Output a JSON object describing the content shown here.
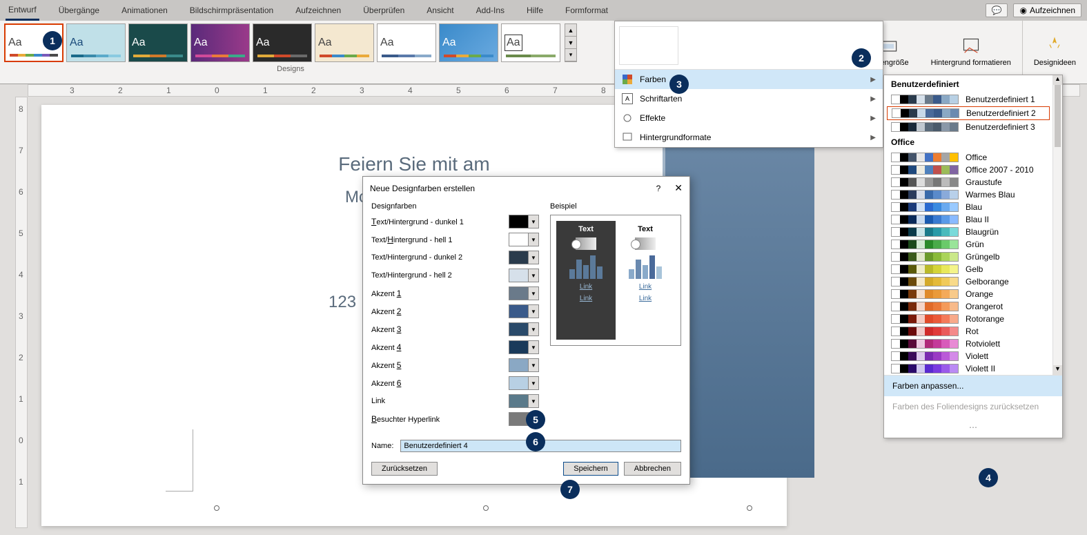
{
  "ribbon": {
    "tabs": [
      "Entwurf",
      "Übergänge",
      "Animationen",
      "Bildschirmpräsentation",
      "Aufzeichnen",
      "Überprüfen",
      "Ansicht",
      "Add-Ins",
      "Hilfe",
      "Formformat"
    ],
    "active": 0,
    "record_btn": "Aufzeichnen",
    "designs_label": "Designs",
    "slide_size": "Foliengröße",
    "format_bg": "Hintergrund formatieren",
    "design_ideas": "Designideen"
  },
  "variants": {
    "colors": "Farben",
    "fonts": "Schriftarten",
    "effects": "Effekte",
    "bg_formats": "Hintergrundformate"
  },
  "colors_flyout": {
    "custom_header": "Benutzerdefiniert",
    "custom_items": [
      "Benutzerdefiniert 1",
      "Benutzerdefiniert 2",
      "Benutzerdefiniert 3"
    ],
    "office_header": "Office",
    "office_items": [
      "Office",
      "Office 2007 - 2010",
      "Graustufe",
      "Warmes Blau",
      "Blau",
      "Blau II",
      "Blaugrün",
      "Grün",
      "Grüngelb",
      "Gelb",
      "Gelborange",
      "Orange",
      "Orangerot",
      "Rotorange",
      "Rot",
      "Rotviolett",
      "Violett",
      "Violett II"
    ],
    "customize": "Farben anpassen...",
    "reset": "Farben des Foliendesigns zurücksetzen"
  },
  "dialog": {
    "title": "Neue Designfarben erstellen",
    "section_colors": "Designfarben",
    "section_preview": "Beispiel",
    "rows": [
      {
        "label": "Text/Hintergrund - dunkel 1",
        "u": "T",
        "color": "#000000"
      },
      {
        "label": "Text/Hintergrund - hell 1",
        "u": "H",
        "color": "#ffffff"
      },
      {
        "label": "Text/Hintergrund - dunkel 2",
        "u": "",
        "color": "#2a3b4c"
      },
      {
        "label": "Text/Hintergrund - hell 2",
        "u": "",
        "color": "#d6e0ea"
      },
      {
        "label": "Akzent 1",
        "u": "1",
        "color": "#6a7a8a"
      },
      {
        "label": "Akzent 2",
        "u": "2",
        "color": "#3a5a8a"
      },
      {
        "label": "Akzent 3",
        "u": "3",
        "color": "#2a4a6a"
      },
      {
        "label": "Akzent 4",
        "u": "4",
        "color": "#1a3a5a"
      },
      {
        "label": "Akzent 5",
        "u": "5",
        "color": "#8aa8c4"
      },
      {
        "label": "Akzent 6",
        "u": "6",
        "color": "#b8d0e4"
      },
      {
        "label": "Link",
        "u": "",
        "color": "#5a7a8a"
      },
      {
        "label": "Besuchter Hyperlink",
        "u": "B",
        "color": "#7a7a7a"
      }
    ],
    "preview_text": "Text",
    "preview_link": "Link",
    "name_label": "Name:",
    "name_value": "Benutzerdefiniert 4",
    "reset_btn": "Zurücksetzen",
    "save_btn": "Speichern",
    "cancel_btn": "Abbrechen"
  },
  "slide": {
    "title": "Feiern Sie mit am",
    "subtitle_prefix": "Mc",
    "address_prefix": "123"
  },
  "swatch_sets": {
    "custom": [
      [
        "#ffffff",
        "#000000",
        "#2a3b4c",
        "#d6e0ea",
        "#6a7a8a",
        "#3a5a8a",
        "#8aa8c4",
        "#b8d0e4"
      ],
      [
        "#ffffff",
        "#000000",
        "#2a3b4c",
        "#c8d8e8",
        "#4a6a9a",
        "#3a5a8a",
        "#8aa8c4",
        "#6a8ab0"
      ],
      [
        "#ffffff",
        "#000000",
        "#1a2a3a",
        "#c0c8d0",
        "#5a6a7a",
        "#4a5a6a",
        "#8a98a8",
        "#6a7a8a"
      ]
    ],
    "office": [
      [
        "#ffffff",
        "#000000",
        "#44546a",
        "#e7e6e6",
        "#4472c4",
        "#ed7d31",
        "#a5a5a5",
        "#ffc000"
      ],
      [
        "#ffffff",
        "#000000",
        "#1f497d",
        "#eeece1",
        "#4f81bd",
        "#c0504d",
        "#9bbb59",
        "#8064a2"
      ],
      [
        "#ffffff",
        "#000000",
        "#555555",
        "#dddddd",
        "#999999",
        "#777777",
        "#bbbbbb",
        "#888888"
      ],
      [
        "#ffffff",
        "#000000",
        "#2a3b5c",
        "#d6dce8",
        "#3a6aaa",
        "#5a8aca",
        "#8aaada",
        "#b8d0ea"
      ],
      [
        "#ffffff",
        "#000000",
        "#1a3a7a",
        "#cfe0f5",
        "#2a6ad0",
        "#3a8ae0",
        "#6aaaf0",
        "#9acaff"
      ],
      [
        "#ffffff",
        "#000000",
        "#0a2a5a",
        "#c8daf0",
        "#1a5ab0",
        "#3a7ad0",
        "#5a9ae8",
        "#8abaff"
      ],
      [
        "#ffffff",
        "#000000",
        "#0a3a4a",
        "#c8e4e8",
        "#1a7a8a",
        "#2a9aa8",
        "#4ababc",
        "#7adada"
      ],
      [
        "#ffffff",
        "#000000",
        "#1a4a1a",
        "#d0e8d0",
        "#2a8a2a",
        "#4aaa4a",
        "#6aca6a",
        "#9ae49a"
      ],
      [
        "#ffffff",
        "#000000",
        "#3a5a1a",
        "#e0e8c8",
        "#6a9a2a",
        "#8aba3a",
        "#aad45a",
        "#cae88a"
      ],
      [
        "#ffffff",
        "#000000",
        "#5a5a0a",
        "#f0eec8",
        "#baba2a",
        "#d4d43a",
        "#e8e85a",
        "#f4f48a"
      ],
      [
        "#ffffff",
        "#000000",
        "#6a4a0a",
        "#f4e8c8",
        "#d4aa2a",
        "#e4ba3a",
        "#f0ca5a",
        "#f8da8a"
      ],
      [
        "#ffffff",
        "#000000",
        "#7a3a0a",
        "#f4dcc8",
        "#e08a2a",
        "#ea9a3a",
        "#f4aa5a",
        "#f8ca8a"
      ],
      [
        "#ffffff",
        "#000000",
        "#7a2a0a",
        "#f4d4c8",
        "#e06a2a",
        "#ea7a3a",
        "#f49a5a",
        "#f8ba8a"
      ],
      [
        "#ffffff",
        "#000000",
        "#7a1a0a",
        "#f4ccc4",
        "#e04a2a",
        "#ea5a3a",
        "#f47a5a",
        "#f8aa8a"
      ],
      [
        "#ffffff",
        "#000000",
        "#6a0a0a",
        "#f0c8c8",
        "#d02a2a",
        "#e03a3a",
        "#ea5a5a",
        "#f48a8a"
      ],
      [
        "#ffffff",
        "#000000",
        "#5a0a3a",
        "#ecc8e0",
        "#b02a7a",
        "#c43a9a",
        "#d85aba",
        "#e88ad4"
      ],
      [
        "#ffffff",
        "#000000",
        "#3a0a5a",
        "#dcc8ec",
        "#7a2ab0",
        "#9a3ac4",
        "#ba5ad8",
        "#d48ae8"
      ],
      [
        "#ffffff",
        "#000000",
        "#2a0a6a",
        "#d0c8f0",
        "#5a2ad0",
        "#7a3ae0",
        "#9a5aea",
        "#ba8af4"
      ]
    ]
  }
}
